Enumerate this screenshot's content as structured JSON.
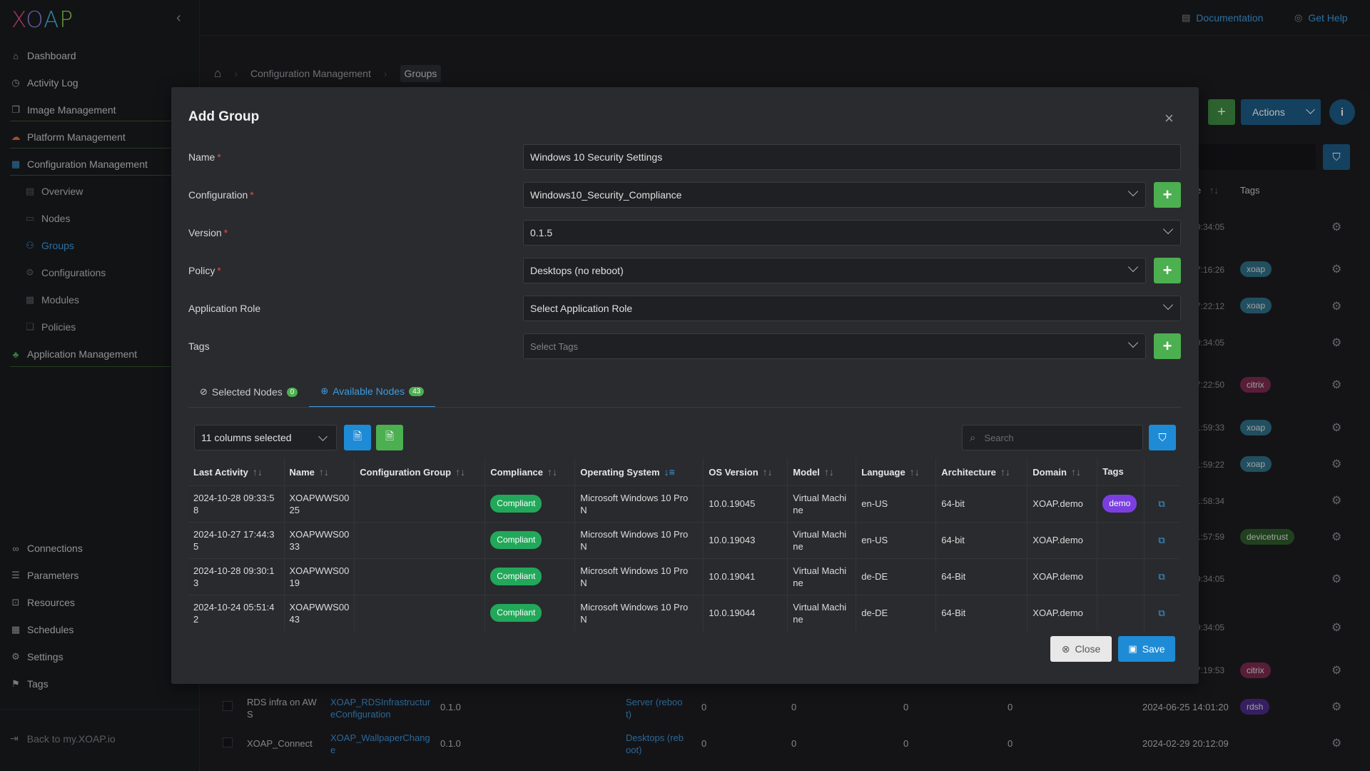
{
  "app": {
    "logo": [
      "X",
      "O",
      "A",
      "P"
    ]
  },
  "sidebar": {
    "items": [
      {
        "label": "Dashboard",
        "icon": "home-icon"
      },
      {
        "label": "Activity Log",
        "icon": "clock-icon"
      },
      {
        "label": "Image Management",
        "icon": "images-icon"
      },
      {
        "label": "Platform Management",
        "icon": "cloud-icon"
      },
      {
        "label": "Configuration Management",
        "icon": "grid-icon"
      },
      {
        "label": "Overview",
        "icon": "overview-icon"
      },
      {
        "label": "Nodes",
        "icon": "monitor-icon"
      },
      {
        "label": "Groups",
        "icon": "groups-icon"
      },
      {
        "label": "Configurations",
        "icon": "cog-icon"
      },
      {
        "label": "Modules",
        "icon": "modules-icon"
      },
      {
        "label": "Policies",
        "icon": "policies-icon"
      },
      {
        "label": "Application Management",
        "icon": "apps-icon"
      }
    ],
    "bottom_items": [
      {
        "label": "Connections",
        "icon": "link-icon"
      },
      {
        "label": "Parameters",
        "icon": "list-icon"
      },
      {
        "label": "Resources",
        "icon": "lock-icon"
      },
      {
        "label": "Schedules",
        "icon": "calendar-icon"
      },
      {
        "label": "Settings",
        "icon": "settings-icon"
      },
      {
        "label": "Tags",
        "icon": "bookmark-icon"
      }
    ],
    "back_link": "Back to my.XOAP.io"
  },
  "topbar": {
    "documentation": "Documentation",
    "get_help": "Get Help"
  },
  "breadcrumb": {
    "level1": "Configuration Management",
    "level2": "Groups"
  },
  "background": {
    "actions_label": "Actions",
    "tags_header": "Tags",
    "times": [
      "9:34:05",
      "7:16:26",
      "7:22:12",
      "9:34:05",
      "7:22:50",
      "1:59:33",
      "1:59:22",
      "1:58:34",
      "1:57:59",
      "9:34:05",
      "9:34:05",
      "7:19:53"
    ],
    "tags": [
      {
        "label": "xoap",
        "color": "#2f6e86"
      },
      {
        "label": "xoap",
        "color": "#2f6e86"
      },
      {
        "label": "citrix",
        "color": "#7a2a4e"
      },
      {
        "label": "xoap",
        "color": "#2f6e86"
      },
      {
        "label": "xoap",
        "color": "#2f6e86"
      },
      {
        "label": "devicetrust",
        "color": "#2e5a2a"
      },
      {
        "label": "citrix",
        "color": "#7a2a4e"
      },
      {
        "label": "rdsh",
        "color": "#4b2c86"
      }
    ],
    "rows": [
      {
        "name": "RDS infra on AW\nS",
        "config": "XOAP_RDSInfrastructur\neConfiguration",
        "version": "0.1.0",
        "policy": "Server (reboo\nt)",
        "c1": "0",
        "c2": "0",
        "c3": "0",
        "c4": "0",
        "date": "2024-06-25 14:01:20"
      },
      {
        "name": "XOAP_Connect",
        "config": "XOAP_WallpaperChang\ne",
        "version": "0.1.0",
        "policy": "Desktops (reb\noot)",
        "c1": "0",
        "c2": "0",
        "c3": "0",
        "c4": "0",
        "date": "2024-02-29 20:12:09"
      }
    ]
  },
  "modal": {
    "title": "Add Group",
    "fields": {
      "name": {
        "label": "Name",
        "value": "Windows 10 Security Settings"
      },
      "configuration": {
        "label": "Configuration",
        "value": "Windows10_Security_Compliance"
      },
      "version": {
        "label": "Version",
        "value": "0.1.5"
      },
      "policy": {
        "label": "Policy",
        "value": "Desktops (no reboot)"
      },
      "application_role": {
        "label": "Application Role",
        "value": "Select Application Role"
      },
      "tags": {
        "label": "Tags",
        "placeholder": "Select Tags"
      }
    },
    "tabs": [
      {
        "label": "Selected Nodes",
        "count": "0"
      },
      {
        "label": "Available Nodes",
        "count": "43"
      }
    ],
    "columns_selected": "11 columns selected",
    "search_placeholder": "Search",
    "table": {
      "headers": [
        "Last Activity",
        "Name",
        "Configuration Group",
        "Compliance",
        "Operating System",
        "OS Version",
        "Model",
        "Language",
        "Architecture",
        "Domain",
        "Tags"
      ],
      "rows": [
        {
          "last_activity": "2024-10-28 09:33:5\n8",
          "name": "XOAPWWS00\n25",
          "group": "",
          "compliance": "Compliant",
          "os": "Microsoft Windows 10 Pro\nN",
          "os_version": "10.0.19045",
          "model": "Virtual Machi\nne",
          "language": "en-US",
          "arch": "64-bit",
          "domain": "XOAP.demo",
          "tag": "demo"
        },
        {
          "last_activity": "2024-10-27 17:44:3\n5",
          "name": "XOAPWWS00\n33",
          "group": "",
          "compliance": "Compliant",
          "os": "Microsoft Windows 10 Pro\nN",
          "os_version": "10.0.19043",
          "model": "Virtual Machi\nne",
          "language": "en-US",
          "arch": "64-bit",
          "domain": "XOAP.demo",
          "tag": ""
        },
        {
          "last_activity": "2024-10-28 09:30:1\n3",
          "name": "XOAPWWS00\n19",
          "group": "",
          "compliance": "Compliant",
          "os": "Microsoft Windows 10 Pro\nN",
          "os_version": "10.0.19041",
          "model": "Virtual Machi\nne",
          "language": "de-DE",
          "arch": "64-Bit",
          "domain": "XOAP.demo",
          "tag": ""
        },
        {
          "last_activity": "2024-10-24 05:51:4\n2",
          "name": "XOAPWWS00\n43",
          "group": "",
          "compliance": "Compliant",
          "os": "Microsoft Windows 10 Pro\nN",
          "os_version": "10.0.19044",
          "model": "Virtual Machi\nne",
          "language": "de-DE",
          "arch": "64-Bit",
          "domain": "XOAP.demo",
          "tag": ""
        }
      ]
    },
    "buttons": {
      "close": "Close",
      "save": "Save"
    }
  },
  "colors": {
    "accent": "#3d9be0",
    "success": "#4caf50",
    "compliant": "#22a85a",
    "demo_tag": "#7b3fe0",
    "save": "#1e8bd6"
  }
}
